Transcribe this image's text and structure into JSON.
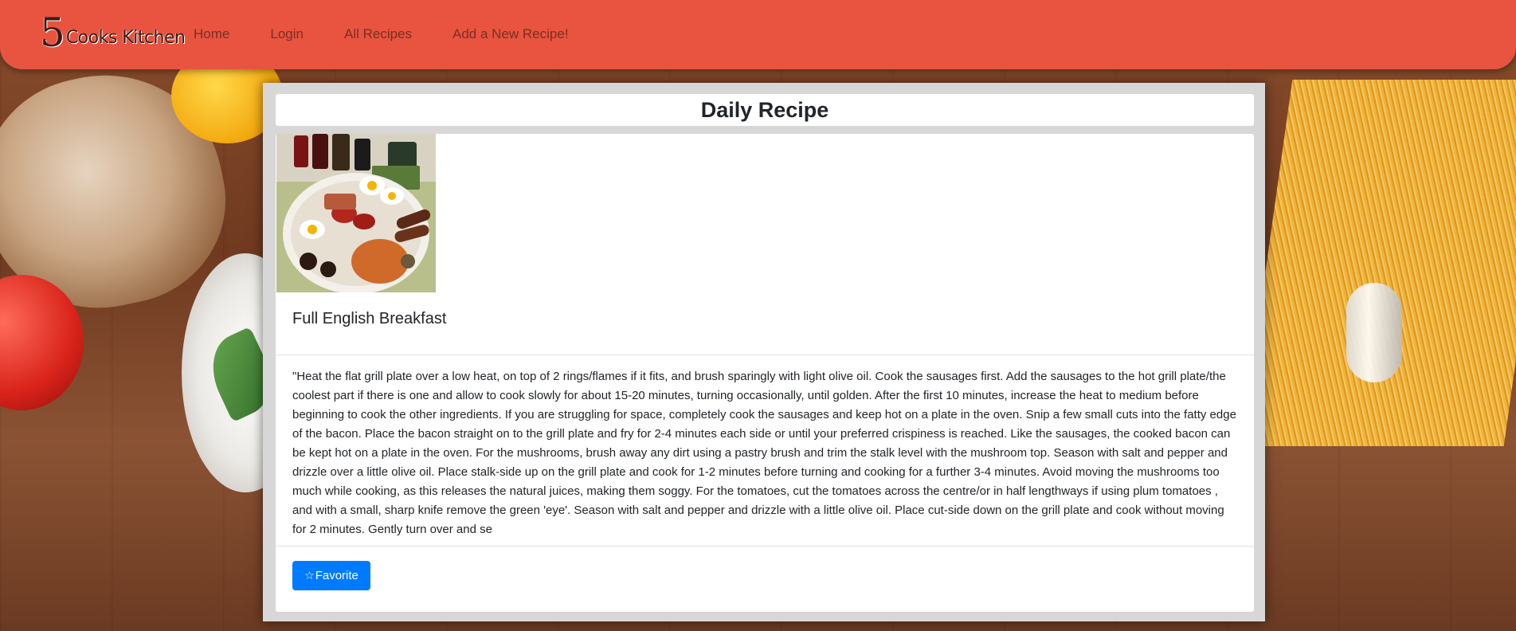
{
  "brand": {
    "number": "5",
    "name": "Cooks Kitchen"
  },
  "nav": {
    "items": [
      {
        "label": "Home"
      },
      {
        "label": "Login"
      },
      {
        "label": "All Recipes"
      },
      {
        "label": "Add a New Recipe!"
      }
    ]
  },
  "page": {
    "title": "Daily Recipe"
  },
  "recipe": {
    "image_icon": "full-english-breakfast-photo",
    "name": "Full English Breakfast",
    "description": "\"Heat the flat grill plate over a low heat, on top of 2 rings/flames if it fits, and brush sparingly with light olive oil. Cook the sausages first. Add the sausages to the hot grill plate/the coolest part if there is one and allow to cook slowly for about 15-20 minutes, turning occasionally, until golden. After the first 10 minutes, increase the heat to medium before beginning to cook the other ingredients. If you are struggling for space, completely cook the sausages and keep hot on a plate in the oven. Snip a few small cuts into the fatty edge of the bacon. Place the bacon straight on to the grill plate and fry for 2-4 minutes each side or until your preferred crispiness is reached. Like the sausages, the cooked bacon can be kept hot on a plate in the oven. For the mushrooms, brush away any dirt using a pastry brush and trim the stalk level with the mushroom top. Season with salt and pepper and drizzle over a little olive oil. Place stalk-side up on the grill plate and cook for 1-2 minutes before turning and cooking for a further 3-4 minutes. Avoid moving the mushrooms too much while cooking, as this releases the natural juices, making them soggy. For the tomatoes, cut the tomatoes across the centre/or in half lengthways if using plum tomatoes , and with a small, sharp knife remove the green 'eye'. Season with salt and pepper and drizzle with a little olive oil. Place cut-side down on the grill plate and cook without moving for 2 minutes. Gently turn over and se"
  },
  "actions": {
    "favorite_label": "Favorite",
    "favorite_icon": "☆"
  },
  "colors": {
    "navbar": "#e85440",
    "button": "#007bff"
  }
}
